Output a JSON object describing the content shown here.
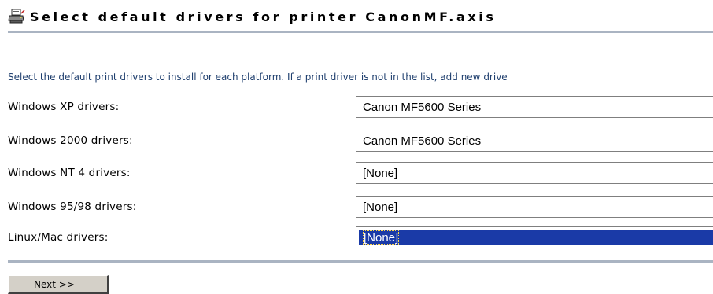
{
  "header": {
    "icon": "printer-icon",
    "title": "Select default drivers for printer CanonMF.axis"
  },
  "intro": {
    "text": "Select the default print drivers to install for each platform. If a print driver is not in the list, add new drive"
  },
  "drivers": [
    {
      "label": "Windows XP drivers:",
      "value": "Canon MF5600 Series"
    },
    {
      "label": "Windows 2000 drivers:",
      "value": "Canon MF5600 Series"
    },
    {
      "label": "Windows NT 4 drivers:",
      "value": "[None]"
    },
    {
      "label": "Windows 95/98 drivers:",
      "value": "[None]"
    },
    {
      "label": "Linux/Mac drivers:",
      "value": "[None]",
      "selected": true
    }
  ],
  "footer": {
    "next_label": "Next >>"
  },
  "colors": {
    "intro_text": "#1f3f6e",
    "rule": "#aab4c2",
    "selection": "#1a3aa7"
  }
}
